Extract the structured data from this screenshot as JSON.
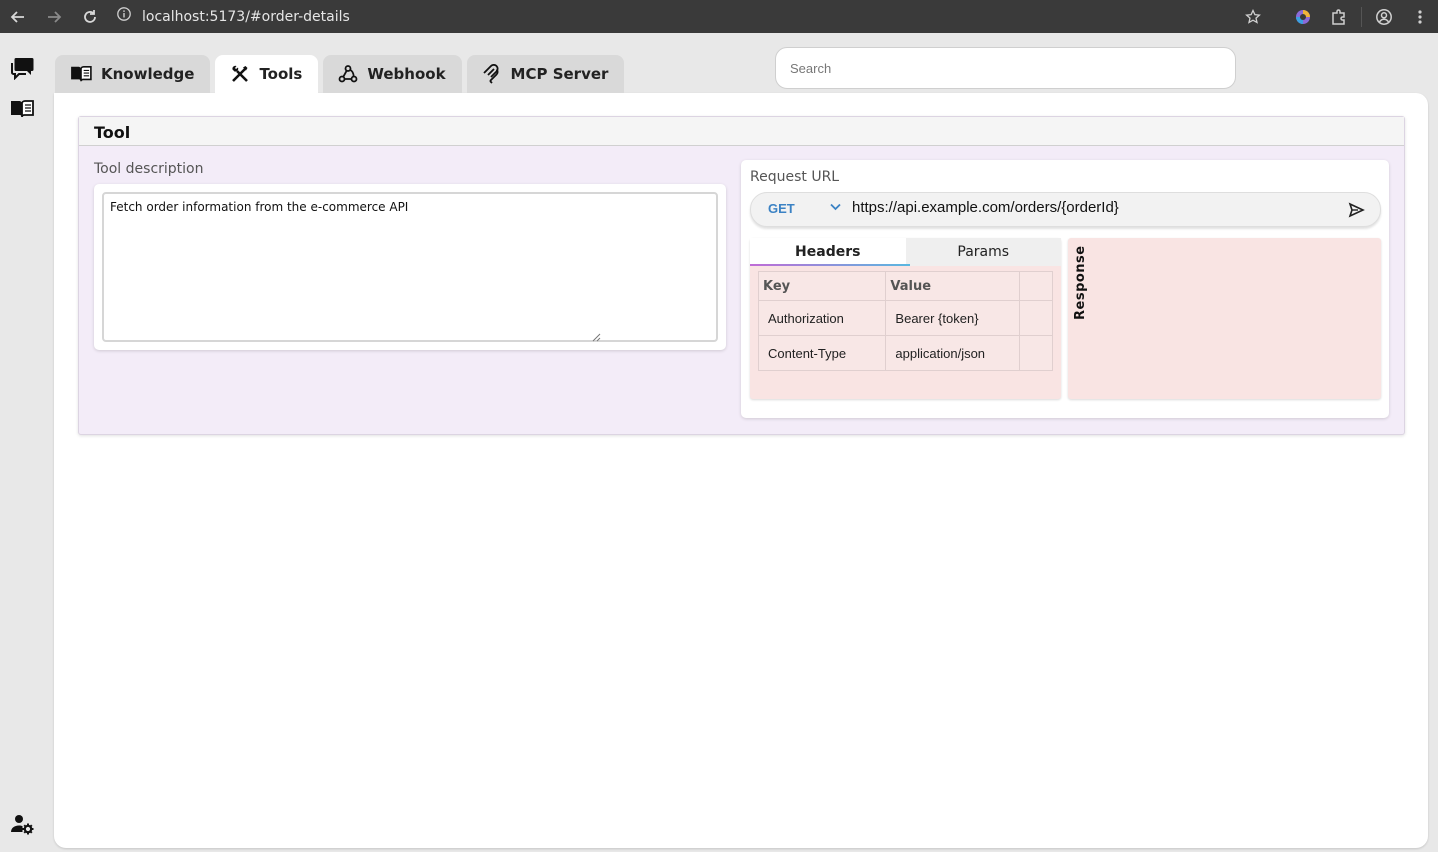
{
  "browser": {
    "url": "localhost:5173/#order-details"
  },
  "tabs": [
    {
      "label": "Knowledge",
      "icon": "book-open-icon"
    },
    {
      "label": "Tools",
      "icon": "tools-icon"
    },
    {
      "label": "Webhook",
      "icon": "webhook-icon"
    },
    {
      "label": "MCP Server",
      "icon": "mcp-icon"
    }
  ],
  "search": {
    "placeholder": "Search"
  },
  "tool": {
    "title": "Tool",
    "description_label": "Tool description",
    "description": "Fetch order information from the e-commerce API",
    "request_label": "Request URL",
    "method": "GET",
    "url": "https://api.example.com/orders/{orderId}",
    "subtabs": [
      "Headers",
      "Params"
    ],
    "table": {
      "columns": [
        "Key",
        "Value"
      ],
      "rows": [
        {
          "key": "Authorization",
          "value": "Bearer {token}"
        },
        {
          "key": "Content-Type",
          "value": "application/json"
        }
      ]
    },
    "response_label": "Response"
  },
  "colors": {
    "accent_method": "#3b82c4",
    "panel_bg": "#f9e4e3",
    "card_bg": "#f3ecf8"
  }
}
